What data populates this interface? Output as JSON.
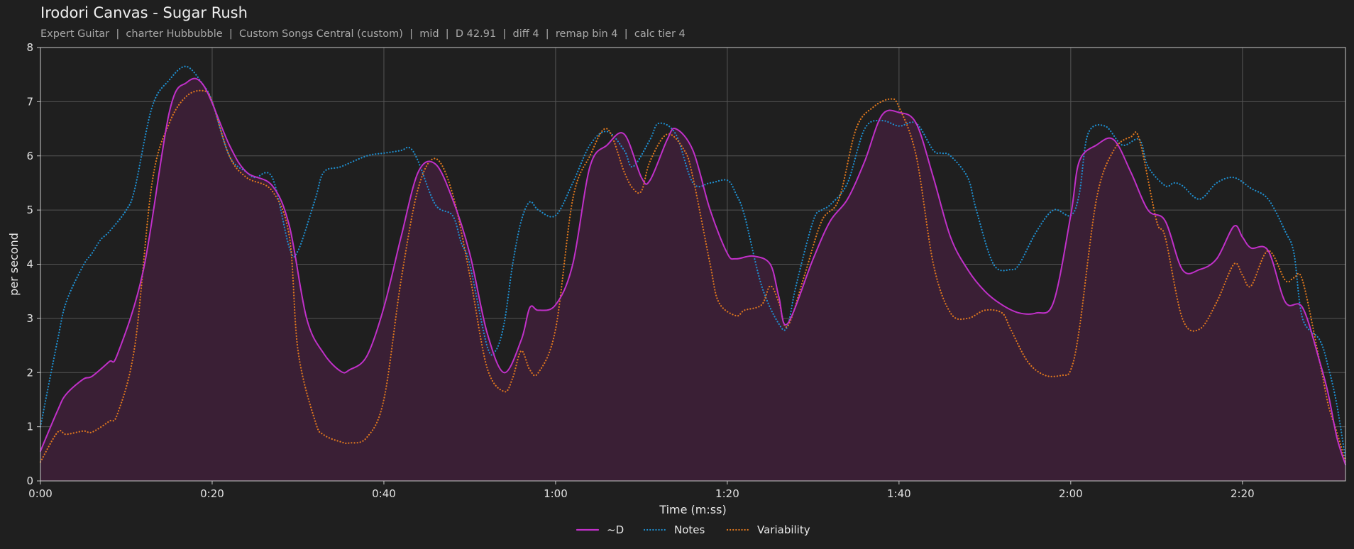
{
  "header": {
    "title": "Irodori Canvas - Sugar Rush",
    "subtitle": "Expert Guitar  |  charter Hubbubble  |  Custom Songs Central (custom)  |  mid  |  D 42.91  |  diff 4  |  remap bin 4  |  calc tier 4"
  },
  "chart_data": {
    "type": "line",
    "xlabel": "Time (m:ss)",
    "ylabel": "per second",
    "xlim": [
      0,
      152
    ],
    "ylim": [
      0,
      8
    ],
    "x_ticks": [
      0,
      20,
      40,
      60,
      80,
      100,
      120,
      140
    ],
    "x_tick_labels": [
      "0:00",
      "0:20",
      "0:40",
      "1:00",
      "1:20",
      "1:40",
      "2:00",
      "2:20"
    ],
    "y_ticks": [
      0,
      1,
      2,
      3,
      4,
      5,
      6,
      7,
      8
    ],
    "y_tick_labels": [
      "0",
      "1",
      "2",
      "3",
      "4",
      "5",
      "6",
      "7",
      "8"
    ],
    "grid": true,
    "legend_position": "bottom-center",
    "colors": {
      "D": "#c030c8",
      "Notes": "#1f8fd0",
      "Variability": "#e0781e",
      "fill": "#3a1f35",
      "grid": "#555555",
      "background": "#1f1f1f"
    },
    "series": [
      {
        "name": "~D",
        "style": "solid",
        "filled": true,
        "x": [
          0,
          2,
          3,
          5,
          6,
          8,
          9,
          12,
          15,
          17,
          19,
          22,
          24,
          27,
          29,
          31,
          33,
          35,
          36,
          38,
          40,
          42,
          44,
          46,
          48,
          50,
          52,
          54,
          56,
          57,
          58,
          60,
          62,
          64,
          66,
          68,
          70,
          71,
          73,
          74,
          76,
          78,
          80,
          81,
          83,
          85,
          86,
          87,
          90,
          92,
          94,
          96,
          98,
          100,
          102,
          104,
          106,
          108,
          110,
          112,
          114,
          116,
          118,
          120,
          121,
          123,
          125,
          127,
          129,
          131,
          133,
          135,
          137,
          139,
          140,
          141,
          143,
          145,
          147,
          149,
          150,
          151,
          152
        ],
        "y": [
          0.55,
          1.3,
          1.6,
          1.88,
          1.93,
          2.2,
          2.35,
          3.9,
          6.8,
          7.35,
          7.3,
          6.2,
          5.7,
          5.45,
          4.7,
          3.0,
          2.35,
          2.02,
          2.05,
          2.3,
          3.2,
          4.5,
          5.7,
          5.85,
          5.2,
          4.2,
          2.75,
          2.0,
          2.6,
          3.2,
          3.15,
          3.25,
          4.0,
          5.8,
          6.2,
          6.4,
          5.6,
          5.55,
          6.3,
          6.5,
          6.1,
          5.0,
          4.2,
          4.1,
          4.15,
          4.0,
          3.4,
          2.9,
          4.1,
          4.8,
          5.2,
          5.9,
          6.75,
          6.8,
          6.6,
          5.6,
          4.5,
          3.9,
          3.5,
          3.25,
          3.1,
          3.1,
          3.3,
          4.9,
          5.9,
          6.2,
          6.3,
          5.7,
          5.0,
          4.8,
          3.9,
          3.9,
          4.1,
          4.7,
          4.5,
          4.3,
          4.25,
          3.3,
          3.2,
          2.2,
          1.6,
          0.8,
          0.3
        ]
      },
      {
        "name": "Notes",
        "style": "dotted",
        "filled": false,
        "x": [
          0,
          2,
          3,
          5,
          6,
          7,
          8,
          10,
          11,
          13,
          15,
          17,
          19,
          20,
          22,
          24,
          25,
          27,
          29,
          30,
          32,
          33,
          35,
          38,
          40,
          42,
          43,
          44,
          46,
          48,
          49,
          50,
          52,
          53,
          54,
          55,
          56,
          57,
          58,
          60,
          62,
          64,
          66,
          68,
          69,
          71,
          72,
          74,
          76,
          78,
          80,
          81,
          82,
          84,
          86,
          87,
          88,
          90,
          91,
          92,
          94,
          96,
          98,
          100,
          102,
          104,
          105,
          106,
          108,
          109,
          111,
          113,
          114,
          116,
          118,
          120,
          121,
          122,
          124,
          126,
          128,
          129,
          131,
          132,
          133,
          135,
          137,
          139,
          141,
          143,
          145,
          146,
          147,
          149,
          150,
          151,
          152
        ],
        "y": [
          1.0,
          2.6,
          3.3,
          3.98,
          4.2,
          4.45,
          4.6,
          5.0,
          5.4,
          6.9,
          7.4,
          7.65,
          7.3,
          7.0,
          6.0,
          5.7,
          5.6,
          5.6,
          4.3,
          4.25,
          5.2,
          5.7,
          5.8,
          6.0,
          6.05,
          6.1,
          6.15,
          5.9,
          5.1,
          4.9,
          4.4,
          4.0,
          2.5,
          2.4,
          2.9,
          4.0,
          4.8,
          5.15,
          5.0,
          4.9,
          5.5,
          6.2,
          6.45,
          6.1,
          5.8,
          6.3,
          6.6,
          6.4,
          5.5,
          5.5,
          5.55,
          5.3,
          4.9,
          3.6,
          2.9,
          2.85,
          3.6,
          4.8,
          5.0,
          5.1,
          5.5,
          6.5,
          6.65,
          6.55,
          6.6,
          6.1,
          6.05,
          6.0,
          5.6,
          5.0,
          4.0,
          3.9,
          4.0,
          4.6,
          5.0,
          4.9,
          5.3,
          6.4,
          6.55,
          6.2,
          6.3,
          5.8,
          5.45,
          5.5,
          5.45,
          5.2,
          5.5,
          5.6,
          5.4,
          5.2,
          4.6,
          4.2,
          3.0,
          2.6,
          2.1,
          1.4,
          0.4
        ]
      },
      {
        "name": "Variability",
        "style": "dotted",
        "filled": false,
        "x": [
          0,
          2,
          3,
          5,
          6,
          8,
          9,
          11,
          13,
          15,
          17,
          19,
          20,
          22,
          24,
          27,
          29,
          30,
          32,
          33,
          35,
          36,
          38,
          40,
          42,
          44,
          46,
          48,
          50,
          52,
          54,
          55,
          56,
          57,
          58,
          60,
          62,
          64,
          66,
          68,
          69,
          70,
          71,
          73,
          75,
          76,
          78,
          79,
          81,
          82,
          84,
          85,
          86,
          87,
          89,
          91,
          93,
          95,
          97,
          99,
          100,
          102,
          104,
          106,
          108,
          110,
          112,
          113,
          115,
          117,
          119,
          120,
          121,
          123,
          125,
          127,
          128,
          130,
          131,
          133,
          135,
          137,
          139,
          140,
          141,
          143,
          145,
          146,
          147,
          149,
          150,
          151,
          152
        ],
        "y": [
          0.35,
          0.9,
          0.86,
          0.92,
          0.9,
          1.1,
          1.25,
          2.5,
          5.5,
          6.6,
          7.1,
          7.2,
          7.0,
          6.0,
          5.6,
          5.35,
          4.5,
          2.4,
          1.1,
          0.85,
          0.72,
          0.7,
          0.8,
          1.5,
          3.7,
          5.4,
          5.95,
          5.3,
          3.8,
          2.1,
          1.65,
          1.9,
          2.4,
          2.05,
          2.0,
          2.8,
          5.2,
          6.0,
          6.5,
          5.7,
          5.4,
          5.35,
          5.9,
          6.4,
          6.1,
          5.6,
          4.0,
          3.3,
          3.05,
          3.15,
          3.25,
          3.6,
          3.3,
          2.85,
          3.8,
          4.8,
          5.2,
          6.5,
          6.9,
          7.05,
          6.9,
          6.0,
          4.0,
          3.1,
          3.0,
          3.15,
          3.1,
          2.8,
          2.2,
          1.95,
          1.95,
          2.05,
          2.8,
          5.2,
          6.1,
          6.35,
          6.3,
          4.8,
          4.5,
          3.0,
          2.8,
          3.3,
          4.0,
          3.8,
          3.6,
          4.25,
          3.7,
          3.75,
          3.7,
          2.2,
          1.4,
          0.9,
          0.35
        ]
      }
    ]
  }
}
